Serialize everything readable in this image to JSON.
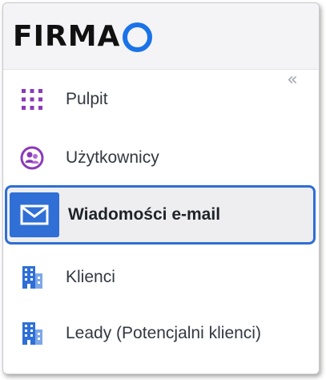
{
  "brand": {
    "logo_text": "FIRMA",
    "logo_icon": "logo-ring-icon",
    "accent_color": "#1a73e8"
  },
  "sidebar": {
    "collapse_icon": "double-chevron-left-icon",
    "items": [
      {
        "label": "Pulpit",
        "icon": "grid-dots-icon",
        "icon_color": "#8a3ab9",
        "active": false
      },
      {
        "label": "Użytkownicy",
        "icon": "users-circle-icon",
        "icon_color": "#8a3ab9",
        "active": false
      },
      {
        "label": "Wiadomości e-mail",
        "icon": "envelope-icon",
        "icon_color": "#ffffff",
        "active": true
      },
      {
        "label": "Klienci",
        "icon": "building-icon",
        "icon_color": "#2f6fd6",
        "active": false
      },
      {
        "label": "Leady (Potencjalni klienci)",
        "icon": "building-icon",
        "icon_color": "#2f6fd6",
        "active": false
      }
    ],
    "active_color": "#2e6fd2"
  }
}
